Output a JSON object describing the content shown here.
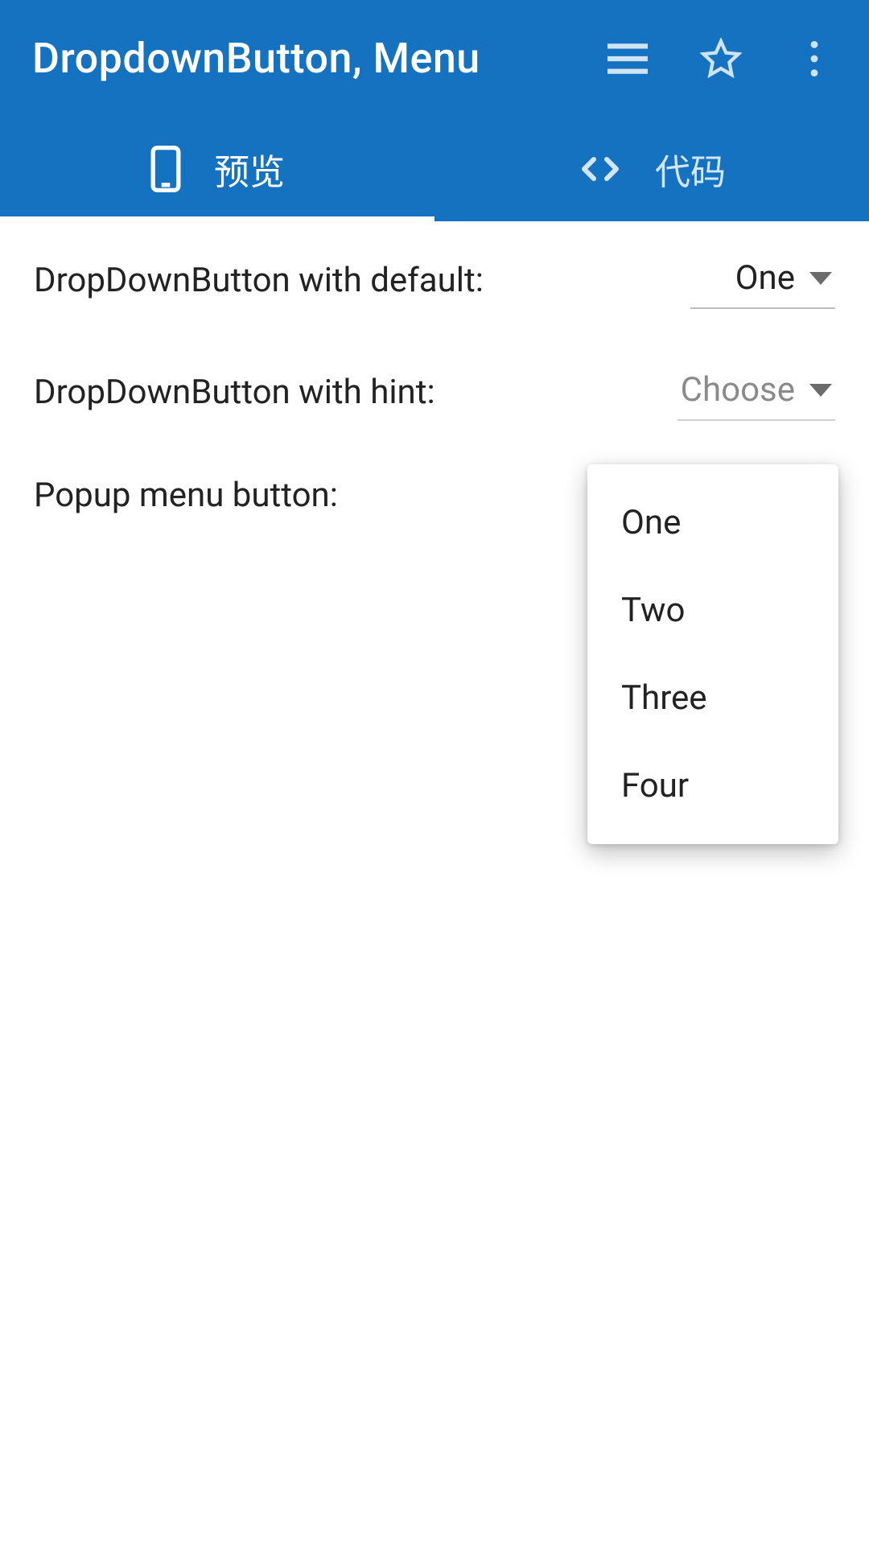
{
  "appbar": {
    "title": "DropdownButton, Menu",
    "tabs": [
      {
        "label": "预览"
      },
      {
        "label": "代码"
      }
    ]
  },
  "rows": {
    "default_label": "DropDownButton with default:",
    "default_value": "One",
    "hint_label": "DropDownButton with hint:",
    "hint_value": "Choose",
    "popup_label": "Popup menu button:"
  },
  "popup_items": [
    "One",
    "Two",
    "Three",
    "Four"
  ]
}
